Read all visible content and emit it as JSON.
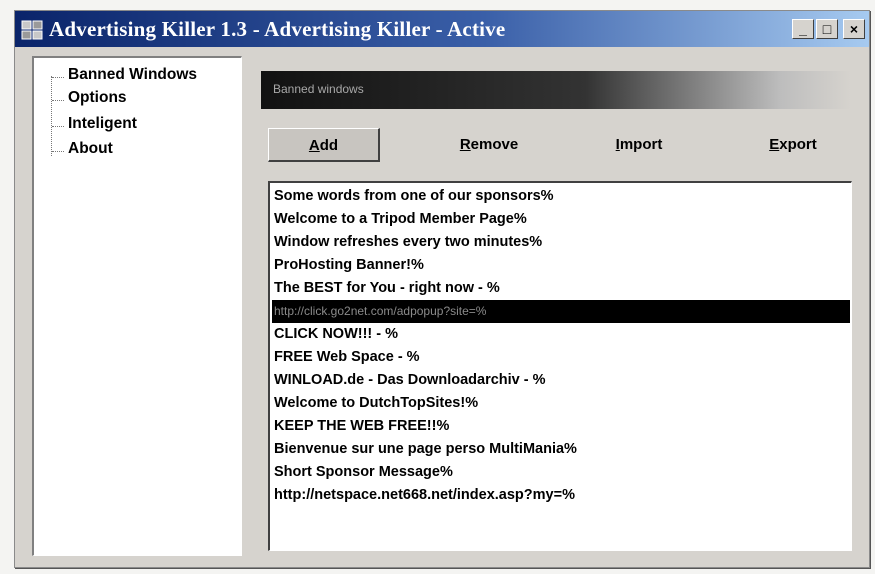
{
  "window": {
    "title": "Advertising Killer 1.3 - Advertising Killer - Active",
    "controls": {
      "minimize": "_",
      "maximize": "□",
      "close": "×"
    }
  },
  "sidebar": {
    "items": [
      {
        "label": "Banned Windows"
      },
      {
        "label": "Options"
      },
      {
        "label": "Inteligent"
      },
      {
        "label": "About"
      }
    ]
  },
  "panel": {
    "header": "Banned windows"
  },
  "toolbar": {
    "add": {
      "mnemonic": "A",
      "rest": "dd"
    },
    "remove": {
      "mnemonic": "R",
      "rest": "emove"
    },
    "import": {
      "mnemonic": "I",
      "rest": "mport"
    },
    "export": {
      "mnemonic": "E",
      "rest": "xport"
    }
  },
  "banned_list": {
    "items": [
      "Some words from one of our sponsors%",
      "Welcome to a Tripod Member Page%",
      "Window refreshes every two minutes%",
      "ProHosting Banner!%",
      "The BEST for You - right now - %",
      "http://click.go2net.com/adpopup?site=%",
      "CLICK NOW!!! - %",
      "FREE Web Space - %",
      "WINLOAD.de - Das Downloadarchiv - %",
      "Welcome to DutchTopSites!%",
      "KEEP THE WEB FREE!!%",
      "Bienvenue sur une page perso MultiMania%",
      "Short Sponsor Message%",
      "http://netspace.net668.net/index.asp?my=%"
    ],
    "selected_index": 5
  }
}
